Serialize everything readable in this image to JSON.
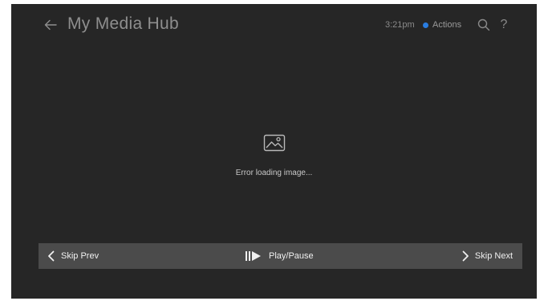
{
  "header": {
    "title": "My Media Hub",
    "time": "3:21pm",
    "actions_label": "Actions",
    "back_icon": "arrow-left-icon",
    "search_icon": "search-icon",
    "help_icon": "question-icon",
    "help_glyph": "?"
  },
  "main": {
    "error_icon": "broken-image-icon",
    "error_text": "Error loading image..."
  },
  "controls": {
    "skip_prev_label": "Skip Prev",
    "play_pause_label": "Play/Pause",
    "skip_next_label": "Skip Next"
  },
  "colors": {
    "background": "#262626",
    "control_bar": "#4b4b4b",
    "accent_dot": "#2a7de1"
  }
}
